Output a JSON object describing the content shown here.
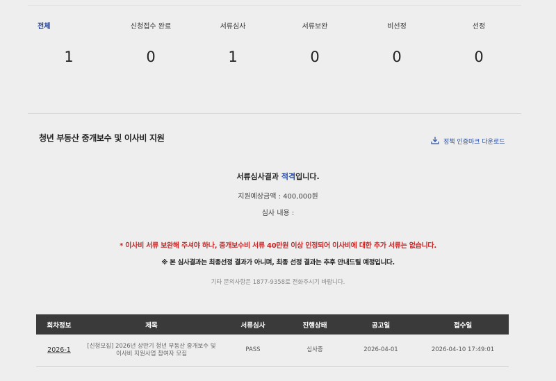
{
  "stats": [
    {
      "label": "전체",
      "count": "1"
    },
    {
      "label": "신청접수 완료",
      "count": "0"
    },
    {
      "label": "서류심사",
      "count": "1"
    },
    {
      "label": "서류보완",
      "count": "0"
    },
    {
      "label": "비선정",
      "count": "0"
    },
    {
      "label": "선정",
      "count": "0"
    }
  ],
  "section": {
    "title": "청년 부동산 중개보수 및 이사비 지원",
    "download_label": "정책 인증마크 다운로드"
  },
  "result": {
    "line1_prefix": "서류심사결과 ",
    "line1_highlight": "적격",
    "line1_suffix": "입니다.",
    "amount": "지원예상금액 : 400,000원",
    "review": "심사 내용 :",
    "notice_red": "* 이사비 서류 보완해 주셔야 하나, 중개보수비 서류 40만원 이상 인정되어 이사비에 대한 추가 서류는 없습니다.",
    "notice_bold": "※ 본 심사결과는 최종선정 결과가 아니며, 최종 선정 결과는 추후 안내드릴 예정입니다.",
    "contact": "기타 문의사항은 1877-9358로 전화주시기 바랍니다."
  },
  "table": {
    "headers": [
      "회차정보",
      "제목",
      "서류심사",
      "진행상태",
      "공고일",
      "접수일"
    ],
    "rows": [
      {
        "round": "2026-1",
        "title": "[신청모집] 2026년 상반기 청년 부동산 중개보수 및 이사비 지원사업 참여자 모집",
        "doc_review": "PASS",
        "status": "심사중",
        "announce_date": "2026-04-01",
        "receipt_date": "2026-04-10 17:49:01"
      }
    ]
  },
  "colors": {
    "accent_blue": "#1e4bb0",
    "notice_red": "#c62828",
    "table_header": "#3a3a3a"
  },
  "icons": {
    "download": "download-icon"
  }
}
